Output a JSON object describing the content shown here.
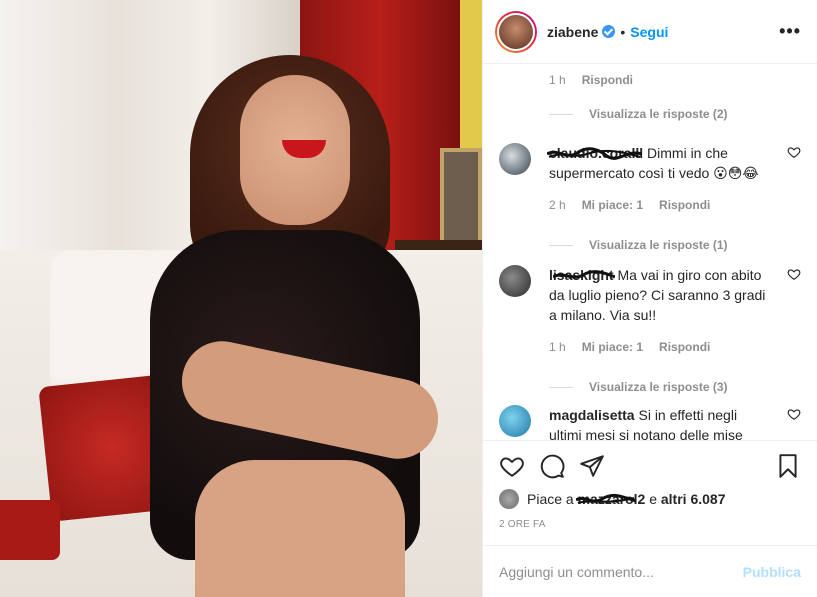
{
  "post": {
    "username": "ziabene",
    "follow_label": "Segui",
    "more_label": "•••"
  },
  "comments": {
    "top_meta": {
      "time": "1 h",
      "reply": "Rispondi"
    },
    "top_view_replies": "Visualizza le risposte (2)",
    "items": [
      {
        "user": "claudio.coralll",
        "text": "Dimmi in che supermercato così ti vedo 😮😳😂",
        "time": "2 h",
        "likes": "Mi piace: 1",
        "reply": "Rispondi",
        "view_replies": "Visualizza le risposte (1)"
      },
      {
        "user": "lisaskight",
        "text": "Ma vai in giro con abito da luglio pieno? Ci saranno 3 gradi a milano. Via su!!",
        "time": "1 h",
        "likes": "Mi piace: 1",
        "reply": "Rispondi",
        "view_replies": "Visualizza le risposte (3)"
      },
      {
        "user": "magdalisetta",
        "text": "Si in effetti negli ultimi mesi si notano delle mise"
      }
    ]
  },
  "likes": {
    "prefix": "Piace a",
    "user": "mazzarol2",
    "suffix": "e",
    "others": "altri 6.087"
  },
  "timestamp": "2 ORE FA",
  "add_comment": {
    "placeholder": "Aggiungi un commento...",
    "publish_label": "Pubblica"
  },
  "icons": {
    "like": "heart-icon",
    "comment": "comment-icon",
    "share": "paper-plane-icon",
    "save": "bookmark-icon"
  },
  "colors": {
    "accent": "#0095f6",
    "publish_disabled": "#b2dffc",
    "verified": "#3897f0"
  }
}
